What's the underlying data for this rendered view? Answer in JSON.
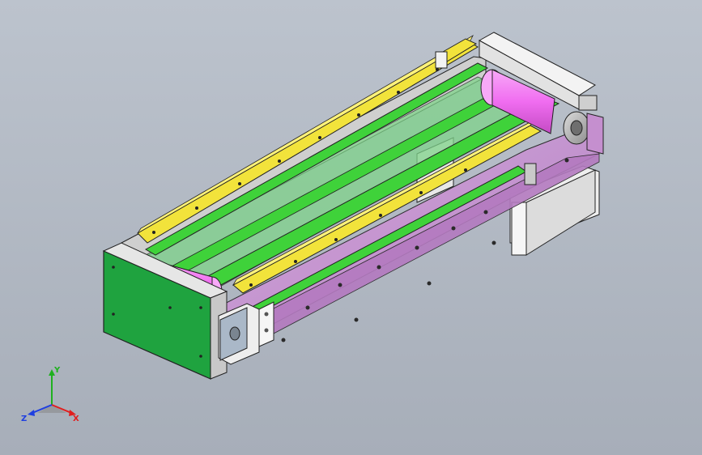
{
  "viewport": {
    "background_top": "#bcc3cd",
    "background_bottom": "#a7aeb9"
  },
  "colors": {
    "green_panel": "#1fa33f",
    "green_belt": "#3fd23a",
    "yellow_rail": "#f2e33b",
    "magenta_roller": "#f06df0",
    "purple_frame": "#c58fcf",
    "white_block": "#f2f2f2",
    "outline": "#1a1a1a"
  },
  "triad": {
    "x_label": "X",
    "y_label": "Y",
    "z_label": "Z",
    "x_color": "#e01f1f",
    "y_color": "#1fb01f",
    "z_color": "#1f3fe0"
  }
}
